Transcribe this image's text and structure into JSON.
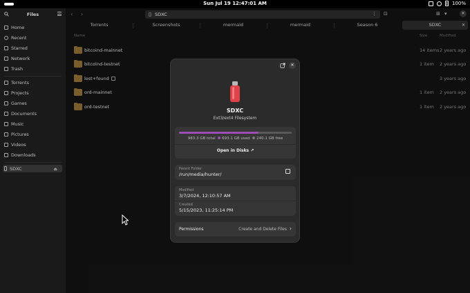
{
  "topbar": {
    "clock": "Sun Jul 19  12:47:01 AM",
    "battery": "100%"
  },
  "sidebar": {
    "title": "Files",
    "places": [
      {
        "label": "Home",
        "icon": "home-icon"
      },
      {
        "label": "Recent",
        "icon": "clock-icon"
      },
      {
        "label": "Starred",
        "icon": "star-icon"
      },
      {
        "label": "Network",
        "icon": "network-icon"
      },
      {
        "label": "Trash",
        "icon": "trash-icon"
      }
    ],
    "bookmarks": [
      {
        "label": "Torrents",
        "icon": "folder-icon"
      },
      {
        "label": "Projects",
        "icon": "folder-icon"
      },
      {
        "label": "Games",
        "icon": "folder-icon"
      },
      {
        "label": "Documents",
        "icon": "document-icon"
      },
      {
        "label": "Music",
        "icon": "music-icon"
      },
      {
        "label": "Pictures",
        "icon": "picture-icon"
      },
      {
        "label": "Videos",
        "icon": "video-icon"
      },
      {
        "label": "Downloads",
        "icon": "download-icon"
      }
    ],
    "device": {
      "label": "SDXC",
      "icon": "usb-drive-icon"
    }
  },
  "header": {
    "path": "SDXC"
  },
  "tabs": [
    "Torrents",
    "Screenshots",
    "mermaid",
    "mermaid",
    "Season 6",
    "SDXC"
  ],
  "columns": {
    "name": "Name",
    "size": "Size",
    "modified": "Modified"
  },
  "files": [
    {
      "name": "bitcoind-mainnet",
      "size": "14 items",
      "modified": "2 years ago"
    },
    {
      "name": "bitcoind-testnet",
      "size": "1 item",
      "modified": "2 years ago"
    },
    {
      "name": "lost+found",
      "size": "",
      "modified": "3 years ago"
    },
    {
      "name": "ord-mainnet",
      "size": "1 item",
      "modified": "2 years ago"
    },
    {
      "name": "ord-testnet",
      "size": "1 item",
      "modified": "2 years ago"
    }
  ],
  "dialog": {
    "name": "SDXC",
    "filesystem": "Ext3/ext4 Filesystem",
    "usage": {
      "total": "983.3 GB total",
      "used": "693.1 GB used",
      "free": "240.1 GB free",
      "used_fraction": 0.705,
      "used_color": "#9b4fb5"
    },
    "open_in_disks": "Open in Disks",
    "parent_folder_label": "Parent Folder",
    "parent_folder": "/run/media/hunter/",
    "modified_label": "Modified",
    "modified": "3/7/2024, 12:10:57 AM",
    "created_label": "Created",
    "created": "5/15/2023, 11:25:14 PM",
    "permissions_label": "Permissions",
    "permissions_value": "Create and Delete Files"
  }
}
